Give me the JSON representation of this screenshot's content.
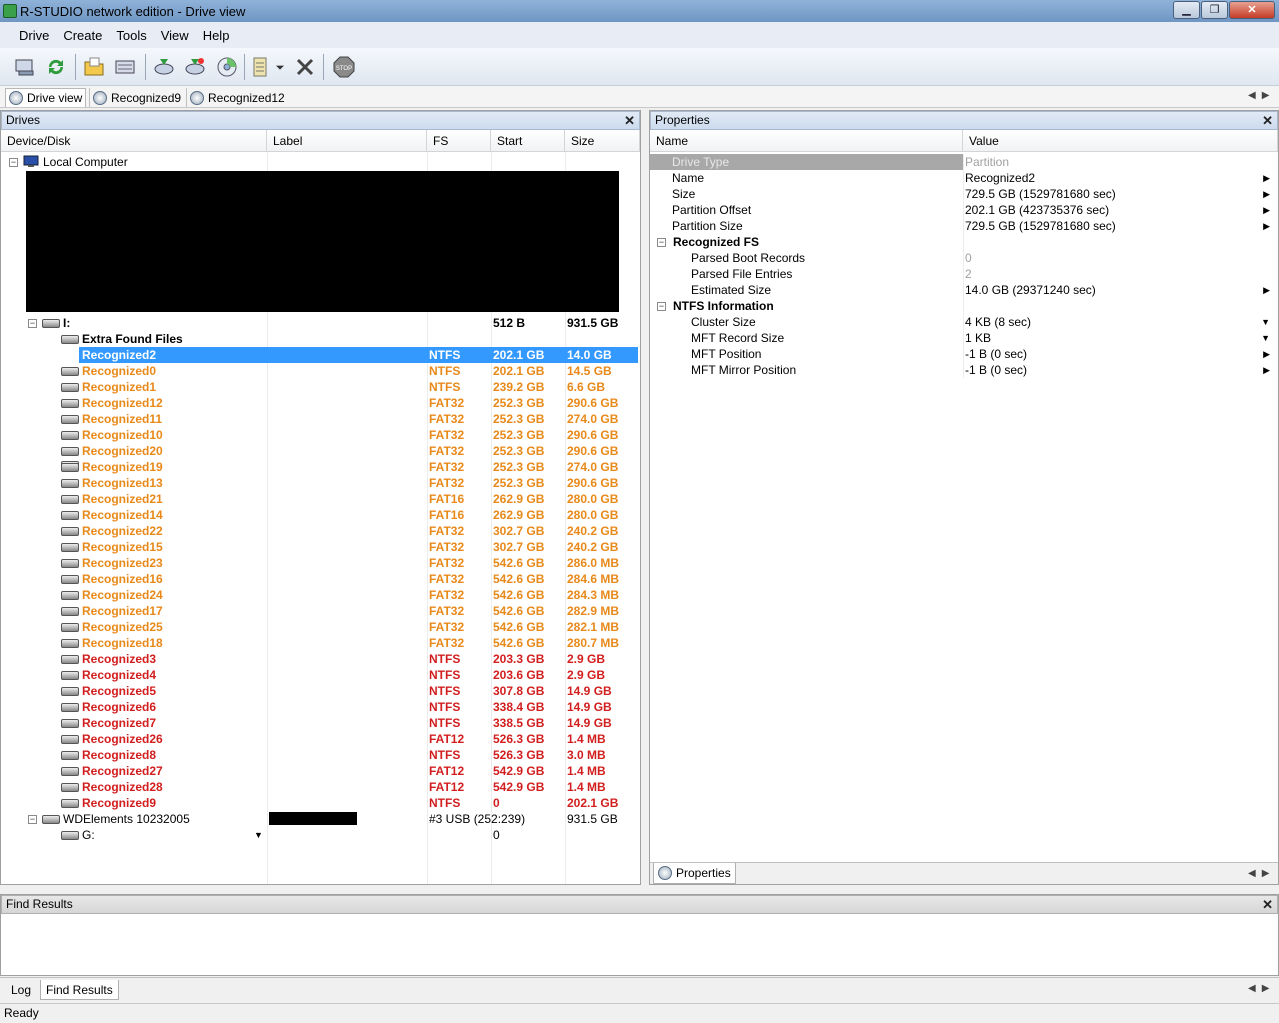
{
  "window": {
    "title": "R-STUDIO network edition - Drive view"
  },
  "menu": [
    "Drive",
    "Create",
    "Tools",
    "View",
    "Help"
  ],
  "doc_tabs": [
    "Drive view",
    "Recognized9",
    "Recognized12"
  ],
  "drives_pane": {
    "title": "Drives",
    "columns": {
      "device": "Device/Disk",
      "label": "Label",
      "fs": "FS",
      "start": "Start",
      "size": "Size"
    },
    "local_computer": "Local Computer",
    "drive_i": {
      "name": "I:",
      "start": "512 B",
      "size": "931.5 GB"
    },
    "extra_found": "Extra Found Files",
    "recognized": [
      {
        "name": "Recognized2",
        "fs": "NTFS",
        "start": "202.1 GB",
        "size": "14.0 GB",
        "color": "#ffffff"
      },
      {
        "name": "Recognized0",
        "fs": "NTFS",
        "start": "202.1 GB",
        "size": "14.5 GB",
        "color": "#e8891a"
      },
      {
        "name": "Recognized1",
        "fs": "NTFS",
        "start": "239.2 GB",
        "size": "6.6 GB",
        "color": "#e8891a"
      },
      {
        "name": "Recognized12",
        "fs": "FAT32",
        "start": "252.3 GB",
        "size": "290.6 GB",
        "color": "#e8891a"
      },
      {
        "name": "Recognized11",
        "fs": "FAT32",
        "start": "252.3 GB",
        "size": "274.0 GB",
        "color": "#e8891a"
      },
      {
        "name": "Recognized10",
        "fs": "FAT32",
        "start": "252.3 GB",
        "size": "290.6 GB",
        "color": "#e8891a"
      },
      {
        "name": "Recognized20",
        "fs": "FAT32",
        "start": "252.3 GB",
        "size": "290.6 GB",
        "color": "#e8891a"
      },
      {
        "name": "Recognized19",
        "fs": "FAT32",
        "start": "252.3 GB",
        "size": "274.0 GB",
        "color": "#e8891a"
      },
      {
        "name": "Recognized13",
        "fs": "FAT32",
        "start": "252.3 GB",
        "size": "290.6 GB",
        "color": "#e8891a"
      },
      {
        "name": "Recognized21",
        "fs": "FAT16",
        "start": "262.9 GB",
        "size": "280.0 GB",
        "color": "#e8891a"
      },
      {
        "name": "Recognized14",
        "fs": "FAT16",
        "start": "262.9 GB",
        "size": "280.0 GB",
        "color": "#e8891a"
      },
      {
        "name": "Recognized22",
        "fs": "FAT32",
        "start": "302.7 GB",
        "size": "240.2 GB",
        "color": "#e8891a"
      },
      {
        "name": "Recognized15",
        "fs": "FAT32",
        "start": "302.7 GB",
        "size": "240.2 GB",
        "color": "#e8891a"
      },
      {
        "name": "Recognized23",
        "fs": "FAT32",
        "start": "542.6 GB",
        "size": "286.0 MB",
        "color": "#e8891a"
      },
      {
        "name": "Recognized16",
        "fs": "FAT32",
        "start": "542.6 GB",
        "size": "284.6 MB",
        "color": "#e8891a"
      },
      {
        "name": "Recognized24",
        "fs": "FAT32",
        "start": "542.6 GB",
        "size": "284.3 MB",
        "color": "#e8891a"
      },
      {
        "name": "Recognized17",
        "fs": "FAT32",
        "start": "542.6 GB",
        "size": "282.9 MB",
        "color": "#e8891a"
      },
      {
        "name": "Recognized25",
        "fs": "FAT32",
        "start": "542.6 GB",
        "size": "282.1 MB",
        "color": "#e8891a"
      },
      {
        "name": "Recognized18",
        "fs": "FAT32",
        "start": "542.6 GB",
        "size": "280.7 MB",
        "color": "#e8891a"
      },
      {
        "name": "Recognized3",
        "fs": "NTFS",
        "start": "203.3 GB",
        "size": "2.9 GB",
        "color": "#d21e1e"
      },
      {
        "name": "Recognized4",
        "fs": "NTFS",
        "start": "203.6 GB",
        "size": "2.9 GB",
        "color": "#d21e1e"
      },
      {
        "name": "Recognized5",
        "fs": "NTFS",
        "start": "307.8 GB",
        "size": "14.9 GB",
        "color": "#d21e1e"
      },
      {
        "name": "Recognized6",
        "fs": "NTFS",
        "start": "338.4 GB",
        "size": "14.9 GB",
        "color": "#d21e1e"
      },
      {
        "name": "Recognized7",
        "fs": "NTFS",
        "start": "338.5 GB",
        "size": "14.9 GB",
        "color": "#d21e1e"
      },
      {
        "name": "Recognized26",
        "fs": "FAT12",
        "start": "526.3 GB",
        "size": "1.4 MB",
        "color": "#d21e1e"
      },
      {
        "name": "Recognized8",
        "fs": "NTFS",
        "start": "526.3 GB",
        "size": "3.0 MB",
        "color": "#d21e1e"
      },
      {
        "name": "Recognized27",
        "fs": "FAT12",
        "start": "542.9 GB",
        "size": "1.4 MB",
        "color": "#d21e1e"
      },
      {
        "name": "Recognized28",
        "fs": "FAT12",
        "start": "542.9 GB",
        "size": "1.4 MB",
        "color": "#d21e1e"
      },
      {
        "name": "Recognized9",
        "fs": "NTFS",
        "start": "0",
        "size": "202.1 GB",
        "color": "#d21e1e"
      }
    ],
    "wd": {
      "name": "WDElements 10232005",
      "fs": "#3  USB (252:239)",
      "size": "931.5 GB"
    },
    "drive_g": {
      "name": "G:",
      "start": "0"
    }
  },
  "properties_pane": {
    "title": "Properties",
    "columns": {
      "name": "Name",
      "value": "Value"
    },
    "rows": [
      {
        "name": "Drive Type",
        "value": "Partition",
        "disabled": true
      },
      {
        "name": "Name",
        "value": "Recognized2",
        "arrow": "▶"
      },
      {
        "name": "Size",
        "value": "729.5 GB (1529781680 sec)",
        "arrow": "▶"
      },
      {
        "name": "Partition Offset",
        "value": "202.1 GB (423735376 sec)",
        "arrow": "▶"
      },
      {
        "name": "Partition Size",
        "value": "729.5 GB (1529781680 sec)",
        "arrow": "▶"
      },
      {
        "name": "Recognized FS",
        "value": "",
        "group": true
      },
      {
        "name": "Parsed Boot Records",
        "value": "0",
        "child": true,
        "grayval": true
      },
      {
        "name": "Parsed File Entries",
        "value": "2",
        "child": true,
        "grayval": true
      },
      {
        "name": "Estimated Size",
        "value": "14.0 GB (29371240 sec)",
        "child": true,
        "arrow": "▶"
      },
      {
        "name": "NTFS Information",
        "value": "",
        "group": true
      },
      {
        "name": "Cluster Size",
        "value": "4 KB (8 sec)",
        "child": true,
        "arrow": "▼"
      },
      {
        "name": "MFT Record Size",
        "value": "1 KB",
        "child": true,
        "arrow": "▼"
      },
      {
        "name": "MFT Position",
        "value": "-1 B (0 sec)",
        "child": true,
        "arrow": "▶"
      },
      {
        "name": "MFT Mirror Position",
        "value": "-1 B (0 sec)",
        "child": true,
        "arrow": "▶"
      }
    ],
    "tab": "Properties"
  },
  "find_results": {
    "title": "Find Results"
  },
  "bottom_tabs": [
    "Log",
    "Find Results"
  ],
  "status": "Ready",
  "icons": [
    "app-icon",
    "minimize-icon",
    "restore-icon",
    "close-icon",
    "connect-icon",
    "refresh-icon",
    "open-folder-icon",
    "scan-icon",
    "recover-icon",
    "recover-marked-icon",
    "disk-image-icon",
    "region-icon",
    "dropdown-arrow-icon",
    "remove-icon",
    "stop-icon"
  ]
}
